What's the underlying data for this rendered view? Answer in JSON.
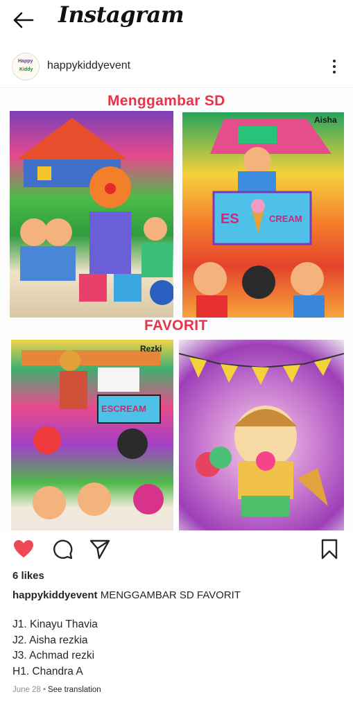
{
  "app": {
    "title": "Instagram"
  },
  "post": {
    "username": "happykiddyevent",
    "avatar_text_line1": "Happy",
    "avatar_text_line2": "Kiddy",
    "image": {
      "heading_top": "Menggambar SD",
      "heading_middle": "FAVORIT",
      "panel_labels": [
        "Aisha",
        "Rezki"
      ],
      "panel_sign_text": [
        "ES",
        "CREAM",
        "ESCREAM"
      ]
    },
    "likes": "6 likes",
    "caption_username": "happykiddyevent",
    "caption_text": "MENGGAMBAR SD FAVORIT",
    "winners": [
      "J1. Kinayu Thavia",
      "J2. Aisha rezkia",
      "J3. Achmad rezki",
      "H1. Chandra A"
    ],
    "date": "June 28",
    "translate_label": "See translation"
  },
  "icons": {
    "back": "arrow-left-icon",
    "more": "more-vertical-icon",
    "like": "heart-filled-icon",
    "comment": "comment-icon",
    "share": "send-icon",
    "save": "bookmark-icon"
  },
  "colors": {
    "like": "#ed4956",
    "heading": "#e8334a",
    "meta": "#8e8e8e"
  }
}
